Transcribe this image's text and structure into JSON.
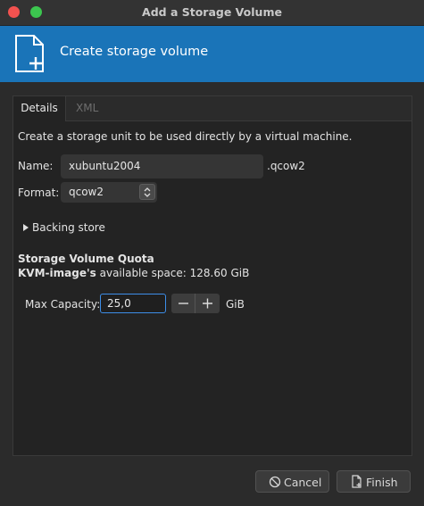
{
  "window": {
    "title": "Add a Storage Volume"
  },
  "banner": {
    "title": "Create storage volume",
    "icon": "new-volume-icon"
  },
  "tabs": [
    {
      "label": "Details",
      "active": true
    },
    {
      "label": "XML",
      "active": false
    }
  ],
  "details": {
    "description": "Create a storage unit to be used directly by a virtual machine.",
    "name_label": "Name:",
    "name_value": "xubuntu2004",
    "name_suffix": ".qcow2",
    "format_label": "Format:",
    "format_value": "qcow2",
    "backing_store_label": "Backing store",
    "quota_heading": "Storage Volume Quota",
    "pool_name": "KVM-image's",
    "available_space_text": "available space: 128.60 GiB",
    "max_capacity_label": "Max Capacity:",
    "max_capacity_value": "25,0",
    "capacity_unit": "GiB"
  },
  "buttons": {
    "cancel_label": "Cancel",
    "finish_label": "Finish"
  },
  "colors": {
    "banner": "#1a74b8",
    "close": "#f3524f",
    "maximize": "#3cc64f",
    "focus": "#3d8ee8"
  }
}
